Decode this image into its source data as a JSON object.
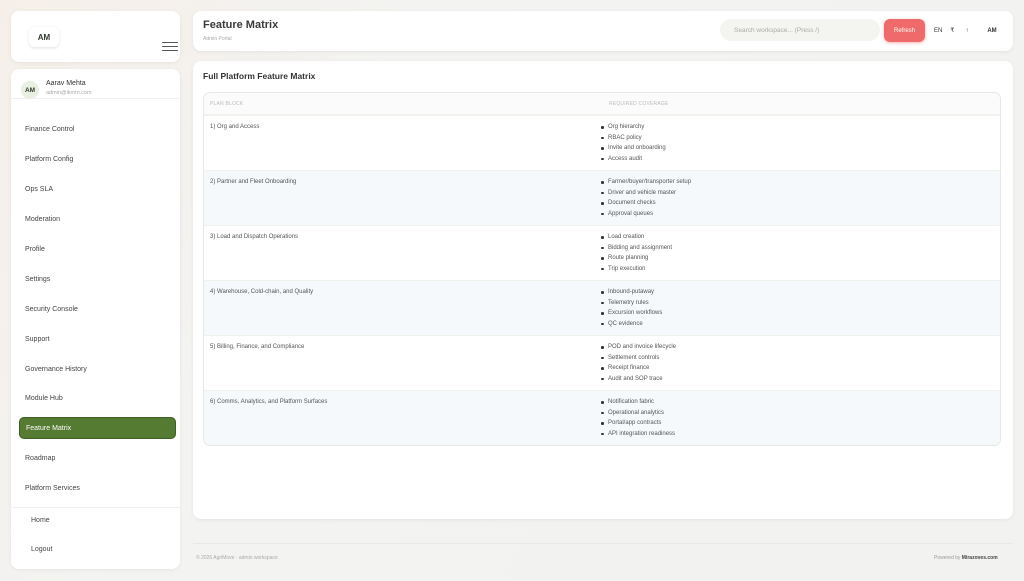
{
  "brand": {
    "initials": "AM"
  },
  "user": {
    "initials": "AM",
    "name": "Aarav Mehta",
    "email": "admin@ikmm.com"
  },
  "nav": {
    "items": [
      {
        "label": "Finance Control"
      },
      {
        "label": "Platform Config"
      },
      {
        "label": "Ops SLA"
      },
      {
        "label": "Moderation"
      },
      {
        "label": "Profile"
      },
      {
        "label": "Settings"
      },
      {
        "label": "Security Console"
      },
      {
        "label": "Support"
      },
      {
        "label": "Governance History"
      },
      {
        "label": "Module Hub"
      },
      {
        "label": "Feature Matrix",
        "active": true
      },
      {
        "label": "Roadmap"
      },
      {
        "label": "Platform Services"
      }
    ],
    "home_label": "Home",
    "logout_label": "Logout"
  },
  "header": {
    "title": "Feature Matrix",
    "subtitle": "Admin Portal",
    "search_placeholder": "Search workspace... (Press /)",
    "refresh_label": "Refresh",
    "lang_label": "EN",
    "currency_label": "₹",
    "upload_label": "↑",
    "profile_initials": "AM"
  },
  "main": {
    "section_title": "Full Platform Feature Matrix",
    "columns": [
      "PLAN BLOCK",
      "REQUIRED COVERAGE"
    ],
    "rows": [
      {
        "block": "1) Org and Access",
        "coverage": [
          "Org hierarchy",
          "RBAC policy",
          "Invite and onboarding",
          "Access audit"
        ]
      },
      {
        "block": "2) Partner and Fleet Onboarding",
        "coverage": [
          "Farmer/buyer/transporter setup",
          "Driver and vehicle master",
          "Document checks",
          "Approval queues"
        ]
      },
      {
        "block": "3) Load and Dispatch Operations",
        "coverage": [
          "Load creation",
          "Bidding and assignment",
          "Route planning",
          "Trip execution"
        ]
      },
      {
        "block": "4) Warehouse, Cold-chain, and Quality",
        "coverage": [
          "Inbound-putaway",
          "Telemetry rules",
          "Excursion workflows",
          "QC evidence"
        ]
      },
      {
        "block": "5) Billing, Finance, and Compliance",
        "coverage": [
          "POD and invoice lifecycle",
          "Settlement controls",
          "Receipt finance",
          "Audit and SOP trace"
        ]
      },
      {
        "block": "6) Comms, Analytics, and Platform Surfaces",
        "coverage": [
          "Notification fabric",
          "Operational analytics",
          "Portal/app contracts",
          "API integration readiness"
        ]
      }
    ]
  },
  "footer": {
    "copyright": "© 2026 AgriMove · admin workspace",
    "powered_prefix": "Powered by",
    "powered_brand": "Mirazoves.com"
  }
}
